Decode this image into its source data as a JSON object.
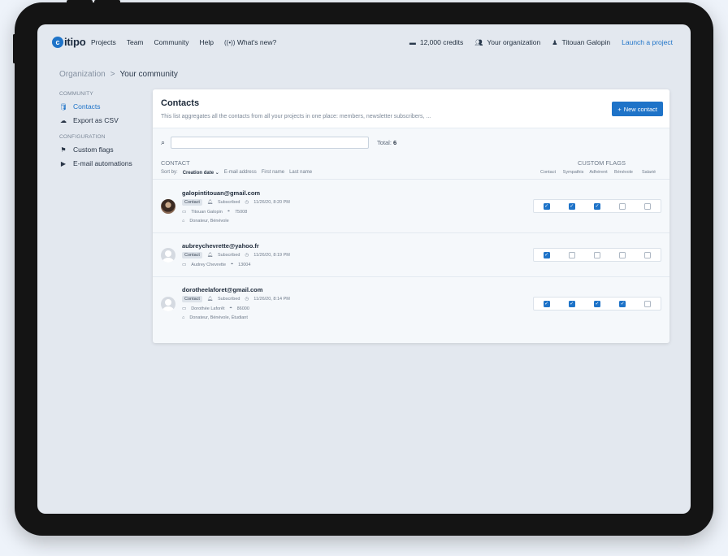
{
  "nav": {
    "logo": "itipo",
    "logo_mark": "c",
    "links": [
      "Projects",
      "Team",
      "Community",
      "Help",
      "What's new?"
    ],
    "whats_new_icon": "broadcast-icon",
    "credits": "12,000 credits",
    "organization": "Your organization",
    "user": "Titouan Galopin",
    "launch": "Launch a project"
  },
  "breadcrumb": {
    "parent": "Organization",
    "separator": ">",
    "current": "Your community"
  },
  "sidebar": {
    "community_title": "COMMUNITY",
    "contacts": "Contacts",
    "export": "Export as CSV",
    "configuration_title": "CONFIGURATION",
    "custom_flags": "Custom flags",
    "email_automations": "E-mail automations"
  },
  "card": {
    "title": "Contacts",
    "description": "This list aggregates all the contacts from all your projects in one place: members, newsletter subscribers, ...",
    "new_button": "New contact",
    "search_placeholder": "",
    "total_label": "Total:",
    "total_value": "6",
    "contact_header": "CONTACT",
    "flags_header": "CUSTOM FLAGS",
    "sort_label": "Sort by:",
    "sort_options": [
      "Creation date",
      "E-mail address",
      "First name",
      "Last name"
    ],
    "sort_arrow": "⌄",
    "flag_columns": [
      "Contact",
      "Sympathis",
      "Adhérent",
      "Bénévole",
      "Salarié"
    ]
  },
  "contacts": [
    {
      "email": "galopintitouan@gmail.com",
      "badge": "Contact",
      "status": "Subscribed",
      "date": "11/26/20, 8:20 PM",
      "name": "Titouan Galopin",
      "postal": "75008",
      "tags": "Donateur, Bénévole",
      "flags": [
        true,
        true,
        true,
        false,
        false
      ]
    },
    {
      "email": "aubreychevrette@yahoo.fr",
      "badge": "Contact",
      "status": "Subscribed",
      "date": "11/26/20, 8:19 PM",
      "name": "Audrey Chevrette",
      "postal": "13004",
      "tags": "",
      "flags": [
        true,
        false,
        false,
        false,
        false
      ]
    },
    {
      "email": "dorotheelaforet@gmail.com",
      "badge": "Contact",
      "status": "Subscribed",
      "date": "11/26/20, 8:14 PM",
      "name": "Dorothée Laforêt",
      "postal": "86000",
      "tags": "Donateur, Bénévole, Étudiant",
      "flags": [
        true,
        true,
        true,
        true,
        false
      ]
    }
  ]
}
